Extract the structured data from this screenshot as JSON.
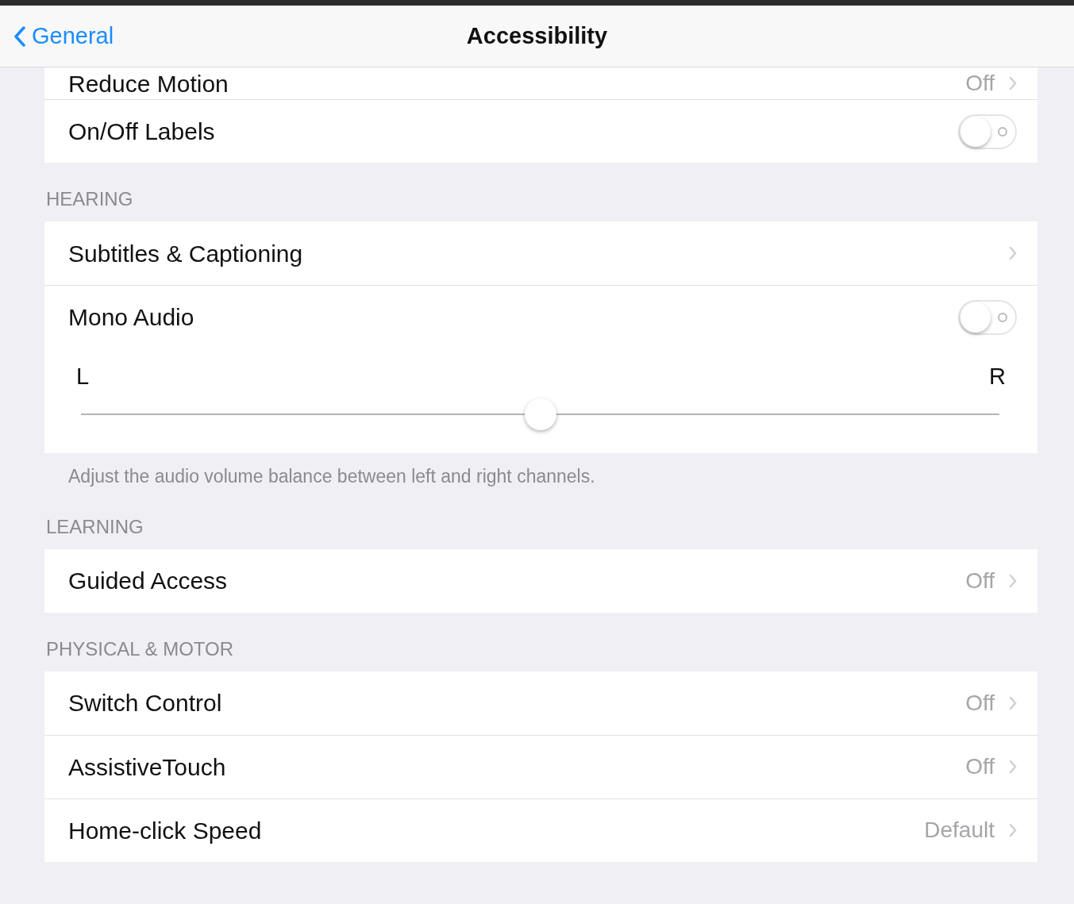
{
  "nav_bar": {
    "back_label": "General",
    "title": "Accessibility"
  },
  "sections": [
    {
      "rows": [
        {
          "kind": "link",
          "label": "Reduce Motion",
          "value": "Off"
        },
        {
          "kind": "toggle",
          "label": "On/Off Labels",
          "on": false
        }
      ]
    },
    {
      "header": "HEARING",
      "rows": [
        {
          "kind": "link",
          "label": "Subtitles & Captioning"
        },
        {
          "kind": "toggle",
          "label": "Mono Audio",
          "on": false
        },
        {
          "kind": "slider",
          "min_label": "L",
          "max_label": "R",
          "level": 0.5
        }
      ],
      "footer": "Adjust the audio volume balance between left and right channels."
    },
    {
      "header": "LEARNING",
      "rows": [
        {
          "kind": "link",
          "label": "Guided Access",
          "value": "Off"
        }
      ]
    },
    {
      "header": "PHYSICAL & MOTOR",
      "rows": [
        {
          "kind": "link",
          "label": "Switch Control",
          "value": "Off"
        },
        {
          "kind": "link",
          "label": "AssistiveTouch",
          "value": "Off"
        },
        {
          "kind": "link",
          "label": "Home-click Speed",
          "value": "Default"
        }
      ]
    }
  ]
}
